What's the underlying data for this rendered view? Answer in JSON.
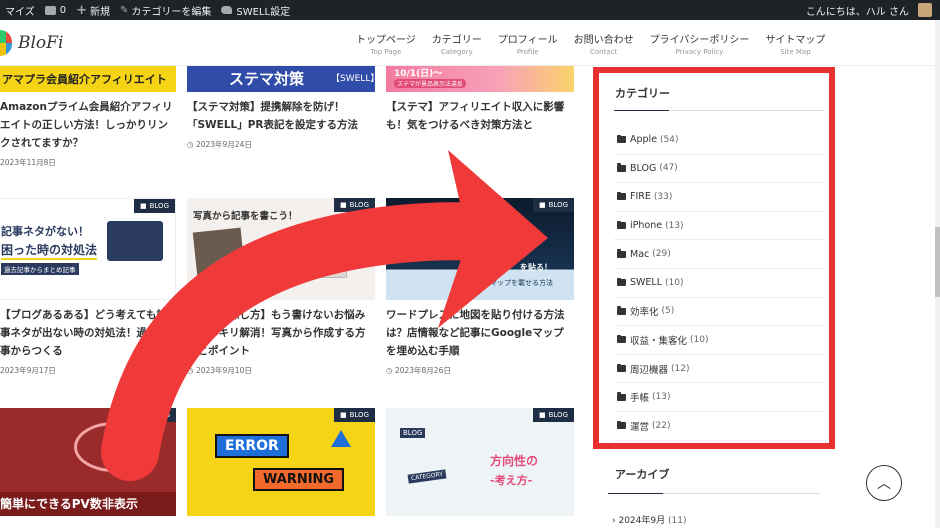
{
  "admin_bar": {
    "customize": "マイズ",
    "comments_count": "0",
    "new": "新規",
    "edit_category": "カテゴリーを編集",
    "swell_settings": "SWELL設定",
    "greeting": "こんにちは、ハル さん"
  },
  "logo": {
    "text": "BloFi"
  },
  "gnav": [
    {
      "main": "トップページ",
      "sub": "Top Page"
    },
    {
      "main": "カテゴリー",
      "sub": "Category"
    },
    {
      "main": "プロフィール",
      "sub": "Profile"
    },
    {
      "main": "お問い合わせ",
      "sub": "Contact"
    },
    {
      "main": "プライバシーポリシー",
      "sub": "Privacy Policy"
    },
    {
      "main": "サイトマップ",
      "sub": "Site Map"
    }
  ],
  "posts": [
    {
      "thumb_text": "アマプラ会員紹介アフィリエイト",
      "title": "Amazonプライム会員紹介アフィリエイトの正しい方法！しっかりリンクされてますか？",
      "date": "2023年11月8日",
      "badge": ""
    },
    {
      "thumb_text": "ステマ対策",
      "thumb_sub": "【SWELL】",
      "title": "【ステマ対策】提携解除を防げ！「SWELL」PR表記を設定する方法",
      "date": "2023年9月24日",
      "badge": ""
    },
    {
      "thumb_text": "10/1(日)～",
      "thumb_sub": "ステマが景品表示法違反",
      "title": "【ステマ】アフィリエイト収入に影響も！気をつけるべき対策方法と",
      "date": "",
      "badge": ""
    },
    {
      "thumb_text": "記事ネタがない！",
      "thumb_sub": "困った時の対処法",
      "thumb_sub2": "過去記事からまとめ記事",
      "title": "【ブログあるある】どう考えても記事ネタが出ない時の対処法！過去記事からつくる",
      "date": "2023年9月17日",
      "badge": "BLOG"
    },
    {
      "thumb_text": "写真から記事を書こう！",
      "title": "【ネタの探し方】もう書けないお悩みがスッキリ解消！写真から作成する方法とポイント",
      "date": "2023年9月10日",
      "badge": "BLOG"
    },
    {
      "thumb_text": "を貼る！",
      "thumb_sub": "マップを載せる方法",
      "title": "ワードプレスに地図を貼り付ける方法は？店情報など記事にGoogleマップを埋め込む手順",
      "date": "2023年8月26日",
      "badge": "BLOG"
    },
    {
      "thumb_text": "簡単にできるPV数非表示",
      "title": "",
      "date": "",
      "badge": "BLOG"
    },
    {
      "thumb_text": "ERROR",
      "thumb_sub": "WARNING",
      "title": "",
      "date": "",
      "badge": "BLOG"
    },
    {
      "thumb_text": "方向性の",
      "thumb_sub": "-考え方-",
      "thumb_sub2": "BLOG",
      "thumb_sub3": "CATEGORY",
      "title": "",
      "date": "",
      "badge": "BLOG"
    }
  ],
  "sidebar": {
    "category_heading": "カテゴリー",
    "categories": [
      {
        "name": "Apple",
        "count": "(54)"
      },
      {
        "name": "BLOG",
        "count": "(47)"
      },
      {
        "name": "FIRE",
        "count": "(33)"
      },
      {
        "name": "iPhone",
        "count": "(13)"
      },
      {
        "name": "Mac",
        "count": "(29)"
      },
      {
        "name": "SWELL",
        "count": "(10)"
      },
      {
        "name": "効率化",
        "count": "(5)"
      },
      {
        "name": "収益・集客化",
        "count": "(10)"
      },
      {
        "name": "周辺機器",
        "count": "(12)"
      },
      {
        "name": "手帳",
        "count": "(13)"
      },
      {
        "name": "運営",
        "count": "(22)"
      }
    ],
    "archive_heading": "アーカイブ",
    "archive_first": "2024年9月",
    "archive_first_count": "(11)"
  },
  "colors": {
    "admin_bar": "#1d2327",
    "highlight_frame": "#e93030",
    "badge_bg": "#1f2e45",
    "arrow": "#f03a3a"
  },
  "icons": [
    "comment-icon",
    "plus-icon",
    "pencil-icon",
    "swell-icon",
    "folder-icon",
    "clock-icon",
    "chevron-up-icon",
    "chevron-right-icon"
  ]
}
